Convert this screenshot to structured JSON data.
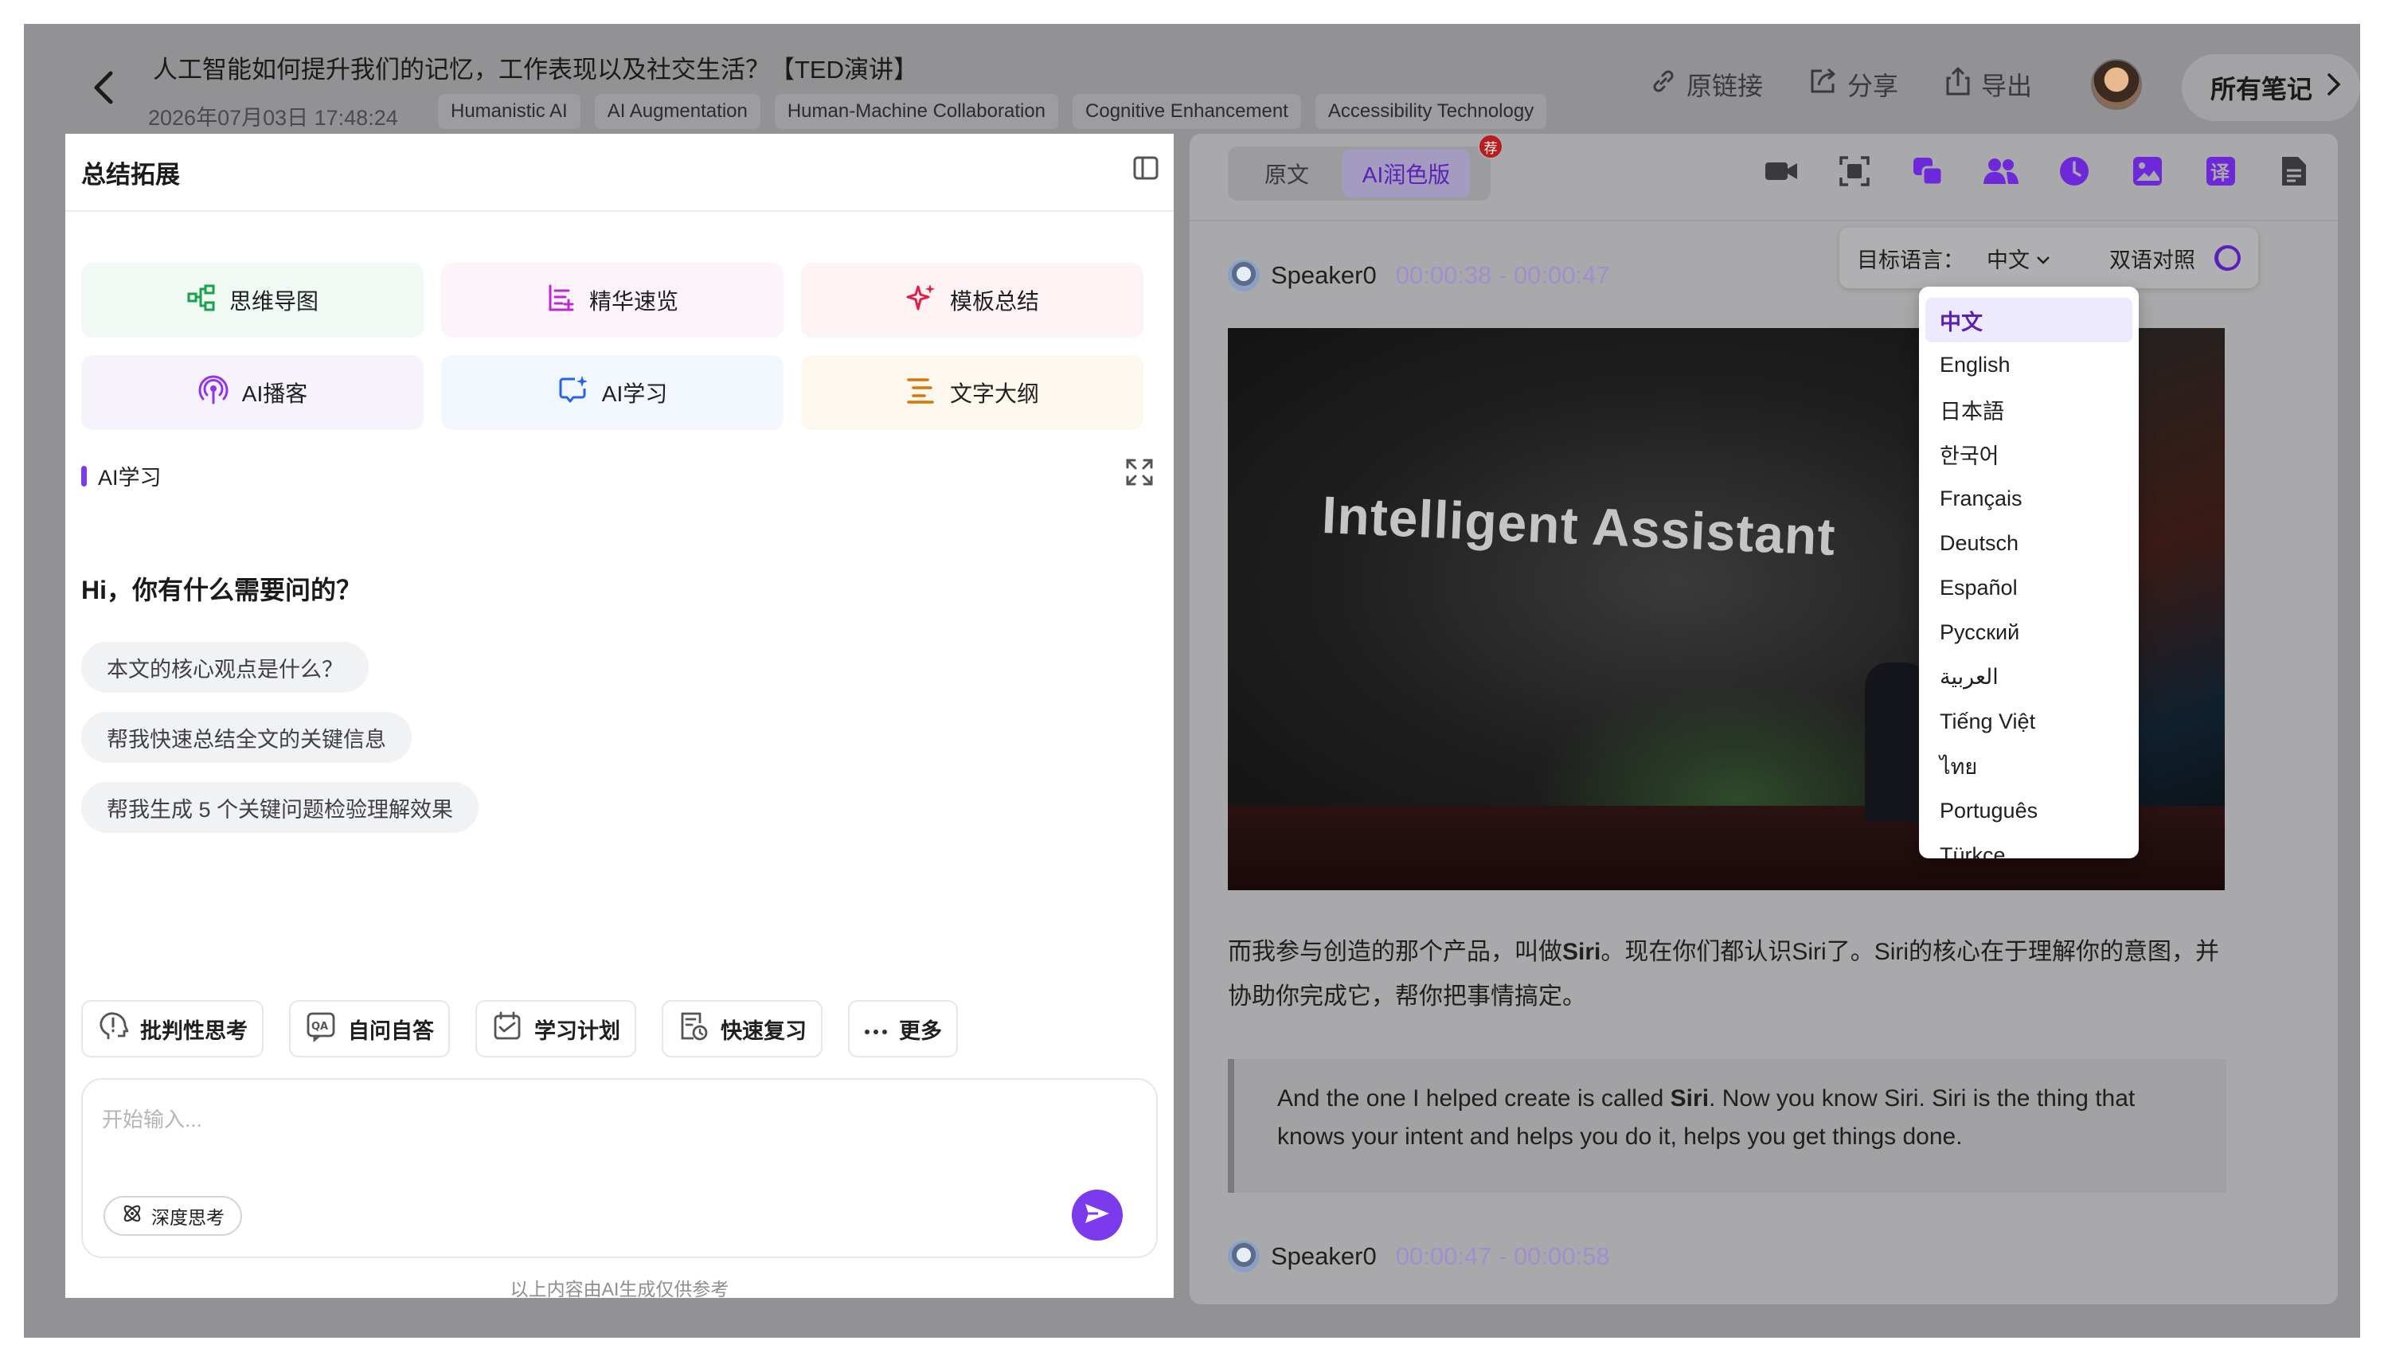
{
  "header": {
    "title": "人工智能如何提升我们的记忆，工作表现以及社交生活？【TED演讲】",
    "datetime": "2026年07月03日 17:48:24",
    "tags": [
      "Humanistic AI",
      "AI Augmentation",
      "Human-Machine Collaboration",
      "Cognitive Enhancement",
      "Accessibility Technology"
    ],
    "actions": {
      "link": "原链接",
      "share": "分享",
      "export": "导出"
    },
    "all_notes": "所有笔记"
  },
  "left": {
    "title": "总结拓展",
    "features": [
      {
        "label": "思维导图",
        "icon": "mindmap-icon",
        "color": "#16a34a"
      },
      {
        "label": "精华速览",
        "icon": "list-icon",
        "color": "#c026d3"
      },
      {
        "label": "模板总结",
        "icon": "sparkle-icon",
        "color": "#e11d48"
      },
      {
        "label": "AI播客",
        "icon": "podcast-icon",
        "color": "#9333ea"
      },
      {
        "label": "AI学习",
        "icon": "chat-sparkle-icon",
        "color": "#2563eb"
      },
      {
        "label": "文字大纲",
        "icon": "outline-icon",
        "color": "#d97706"
      }
    ],
    "section_label": "AI学习",
    "greeting": "Hi，你有什么需要问的？",
    "suggestions": [
      "本文的核心观点是什么？",
      "帮我快速总结全文的关键信息",
      "帮我生成 5 个关键问题检验理解效果"
    ],
    "tools": [
      {
        "label": "批判性思考",
        "icon": "lightbulb-head-icon"
      },
      {
        "label": "自问自答",
        "icon": "qa-icon"
      },
      {
        "label": "学习计划",
        "icon": "plan-icon"
      },
      {
        "label": "快速复习",
        "icon": "review-icon"
      },
      {
        "label": "更多",
        "icon": "more-icon"
      }
    ],
    "input_placeholder": "开始输入...",
    "deep_think": "深度思考",
    "disclaimer": "以上内容由AI生成仅供参考"
  },
  "right": {
    "tabs": [
      "原文",
      "AI润色版"
    ],
    "badge": "荐",
    "target_lang_label": "目标语言：",
    "target_lang": "中文",
    "bilingual_label": "双语对照",
    "bilingual_on": true,
    "languages": [
      "中文",
      "English",
      "日本語",
      "한국어",
      "Français",
      "Deutsch",
      "Español",
      "Русский",
      "العربية",
      "Tiếng Việt",
      "ไทย",
      "Português",
      "Türkçe"
    ],
    "selected_language": "中文",
    "segments": [
      {
        "speaker": "Speaker0",
        "time": "00:00:38 - 00:00:47"
      },
      {
        "speaker": "Speaker0",
        "time": "00:00:47 - 00:00:58"
      }
    ],
    "video_text": "Intelligent Assistant",
    "para_zh_1": "而我参与创造的那个产品，叫做",
    "para_zh_bold": "Siri",
    "para_zh_2": "。现在你们都认识Siri了。Siri的核心在于理解你的意图，并协助你完成它，帮你把事情搞定。",
    "para_en_1": "And the one I helped create is called ",
    "para_en_bold": "Siri",
    "para_en_2": ". Now you know Siri. Siri is the thing that knows your intent and helps you do it, helps you get things done."
  }
}
